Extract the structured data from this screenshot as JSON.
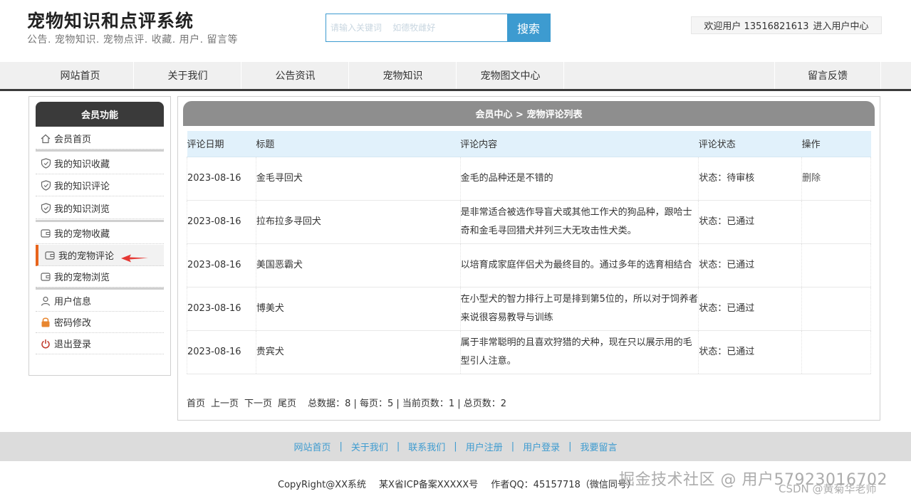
{
  "header": {
    "title": "宠物知识和点评系统",
    "subtitle": "公告. 宠物知识. 宠物点评. 收藏. 用户. 留言等",
    "search_placeholder": "请输入关键词    如德牧雌好",
    "search_button": "搜索",
    "welcome_text": "欢迎用户 13516821613",
    "user_center_link": "进入用户中心"
  },
  "nav": {
    "items": [
      {
        "label": "网站首页"
      },
      {
        "label": "关于我们"
      },
      {
        "label": "公告资讯"
      },
      {
        "label": "宠物知识"
      },
      {
        "label": "宠物图文中心"
      },
      {
        "label": "留言反馈"
      }
    ]
  },
  "sidebar": {
    "title": "会员功能",
    "items": [
      {
        "label": "会员首页",
        "icon": "home-icon"
      },
      {
        "label": "我的知识收藏",
        "icon": "shield-icon"
      },
      {
        "label": "我的知识评论",
        "icon": "shield-icon"
      },
      {
        "label": "我的知识浏览",
        "icon": "shield-icon"
      },
      {
        "label": "我的宠物收藏",
        "icon": "wallet-icon"
      },
      {
        "label": "我的宠物评论",
        "icon": "wallet-icon"
      },
      {
        "label": "我的宠物浏览",
        "icon": "wallet-icon"
      },
      {
        "label": "用户信息",
        "icon": "user-icon"
      },
      {
        "label": "密码修改",
        "icon": "lock-icon"
      },
      {
        "label": "退出登录",
        "icon": "power-icon"
      }
    ],
    "active_index": 5,
    "accent_color": "#e8641b",
    "arrow_color": "#e53935"
  },
  "main": {
    "breadcrumb": "会员中心 > 宠物评论列表",
    "table": {
      "headers": [
        "评论日期",
        "标题",
        "评论内容",
        "评论状态",
        "操作"
      ],
      "rows": [
        {
          "date": "2023-08-16",
          "title": "金毛寻回犬",
          "content": "金毛的品种还是不错的",
          "status": "状态：待审核",
          "action": "删除"
        },
        {
          "date": "2023-08-16",
          "title": "拉布拉多寻回犬",
          "content": "是非常适合被选作导盲犬或其他工作犬的狗品种，跟哈士奇和金毛寻回猎犬并列三大无攻击性犬类。",
          "status": "状态：已通过",
          "action": ""
        },
        {
          "date": "2023-08-16",
          "title": "美国恶霸犬",
          "content": "以培育成家庭伴侣犬为最终目的。通过多年的选育相结合",
          "status": "状态：已通过",
          "action": ""
        },
        {
          "date": "2023-08-16",
          "title": "博美犬",
          "content": "在小型犬的智力排行上可是排到第5位的，所以对于饲养者来说很容易教导与训练",
          "status": "状态：已通过",
          "action": ""
        },
        {
          "date": "2023-08-16",
          "title": "贵宾犬",
          "content": "属于非常聪明的且喜欢狩猎的犬种，现在只以展示用的毛型引人注意。",
          "status": "状态：已通过",
          "action": ""
        }
      ]
    },
    "pager": {
      "first": "首页",
      "prev": "上一页",
      "next": "下一页",
      "last": "尾页",
      "summary": "总数据：8 | 每页：5 | 当前页数：1 | 总页数：2"
    }
  },
  "footer": {
    "links": [
      "网站首页",
      "关于我们",
      "联系我们",
      "用户注册",
      "用户登录",
      "我要留言"
    ],
    "separator": "|",
    "copyright": "CopyRight@XX系统",
    "icp": "某X省ICP备案XXXXX号",
    "author": "作者QQ：45157718（微信同号）",
    "watermark_main": "掘金技术社区 @ 用户57923016702",
    "watermark_csdn": "CSDN @黄菊华老师"
  },
  "colors": {
    "accent_blue": "#3d9bd0",
    "dark_header": "#3a3a3a",
    "table_header_bg": "#e1f1fb"
  }
}
